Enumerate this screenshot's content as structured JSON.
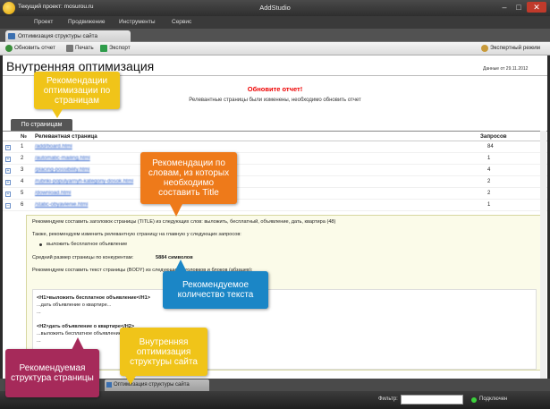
{
  "window": {
    "project_label": "Текущий проект: mosurou.ru",
    "app_title": "AddStudio"
  },
  "menu": [
    "Проект",
    "Продвижение",
    "Инструменты",
    "Сервис"
  ],
  "tab": {
    "label": "Оптимизация структуры сайта"
  },
  "toolbar": {
    "refresh": "Обновить отчет",
    "print": "Печать",
    "export": "Экспорт",
    "expert_mode": "Экспертный режим"
  },
  "page": {
    "title": "Внутренняя оптимизация",
    "data_date": "Данные от 29.11.2012",
    "update_title": "Обновите отчет!",
    "update_text": "Релевантные страницы были изменены, необходимо обновить отчет"
  },
  "subtab": "По страницам",
  "table": {
    "headers": {
      "num": "№",
      "page": "Релевантная страница",
      "queries": "Запросов"
    },
    "rows": [
      {
        "num": "1",
        "url": "/add/board.html",
        "count": "84"
      },
      {
        "num": "2",
        "url": "/automatic-mailing.html",
        "count": "1"
      },
      {
        "num": "3",
        "url": "/placing-possibility.html",
        "count": "4"
      },
      {
        "num": "4",
        "url": "/rubriki-populyarnyh-kategoriy-dosok.html",
        "count": "2"
      },
      {
        "num": "5",
        "url": "/download.html",
        "count": "2"
      },
      {
        "num": "6",
        "url": "/static-obyavlenie.html",
        "count": "1"
      }
    ]
  },
  "recommendation": {
    "title_rec": "Рекомендуем составить заголовок страницы (TITLE) из следующих слов: выложить, бесплатный, объявление, дать, квартира (48)",
    "also_text": "Также, рекомендуем изменить релевантную страницу на главную у следующих запросов:",
    "query_item": "выложить бесплатное объявление",
    "avg_size_label": "Средний размер страницы по конкурентам:",
    "avg_size_value": "5884 символов",
    "body_rec": "Рекомендуем составить текст страницы (BODY) из следующих заголовков и блоков (абзацев):",
    "h1": "<H1>выложить бесплатное объявление</H1>",
    "h1_text": "...дать объявление о квартире...",
    "dots1": "...",
    "h2a": "<H2>дать объявление о квартире</H2>",
    "h2a_text": "...выложить бесплатное объявление...",
    "dots2": "..."
  },
  "bottom_tab": "Оптимизация структуры сайта",
  "status": {
    "filter_label": "Фильтр:",
    "filter_value": "",
    "connection": "Подключен"
  },
  "callouts": {
    "pages": "Рекомендации оптимизации по страницам",
    "words": "Рекомендации по словам, из которых необходимо составить Title",
    "text_amount": "Рекомендуемое количество текста",
    "structure": "Рекомендуемая структура страницы",
    "internal": "Внутренняя оптимизация структуры сайта"
  },
  "colors": {
    "callout_yellow": "#f0c419",
    "callout_orange": "#ee7a1a",
    "callout_blue": "#1b86c6",
    "callout_magenta": "#a62a5a",
    "warning_red": "#e00000",
    "status_connected": "#3bd23b"
  }
}
